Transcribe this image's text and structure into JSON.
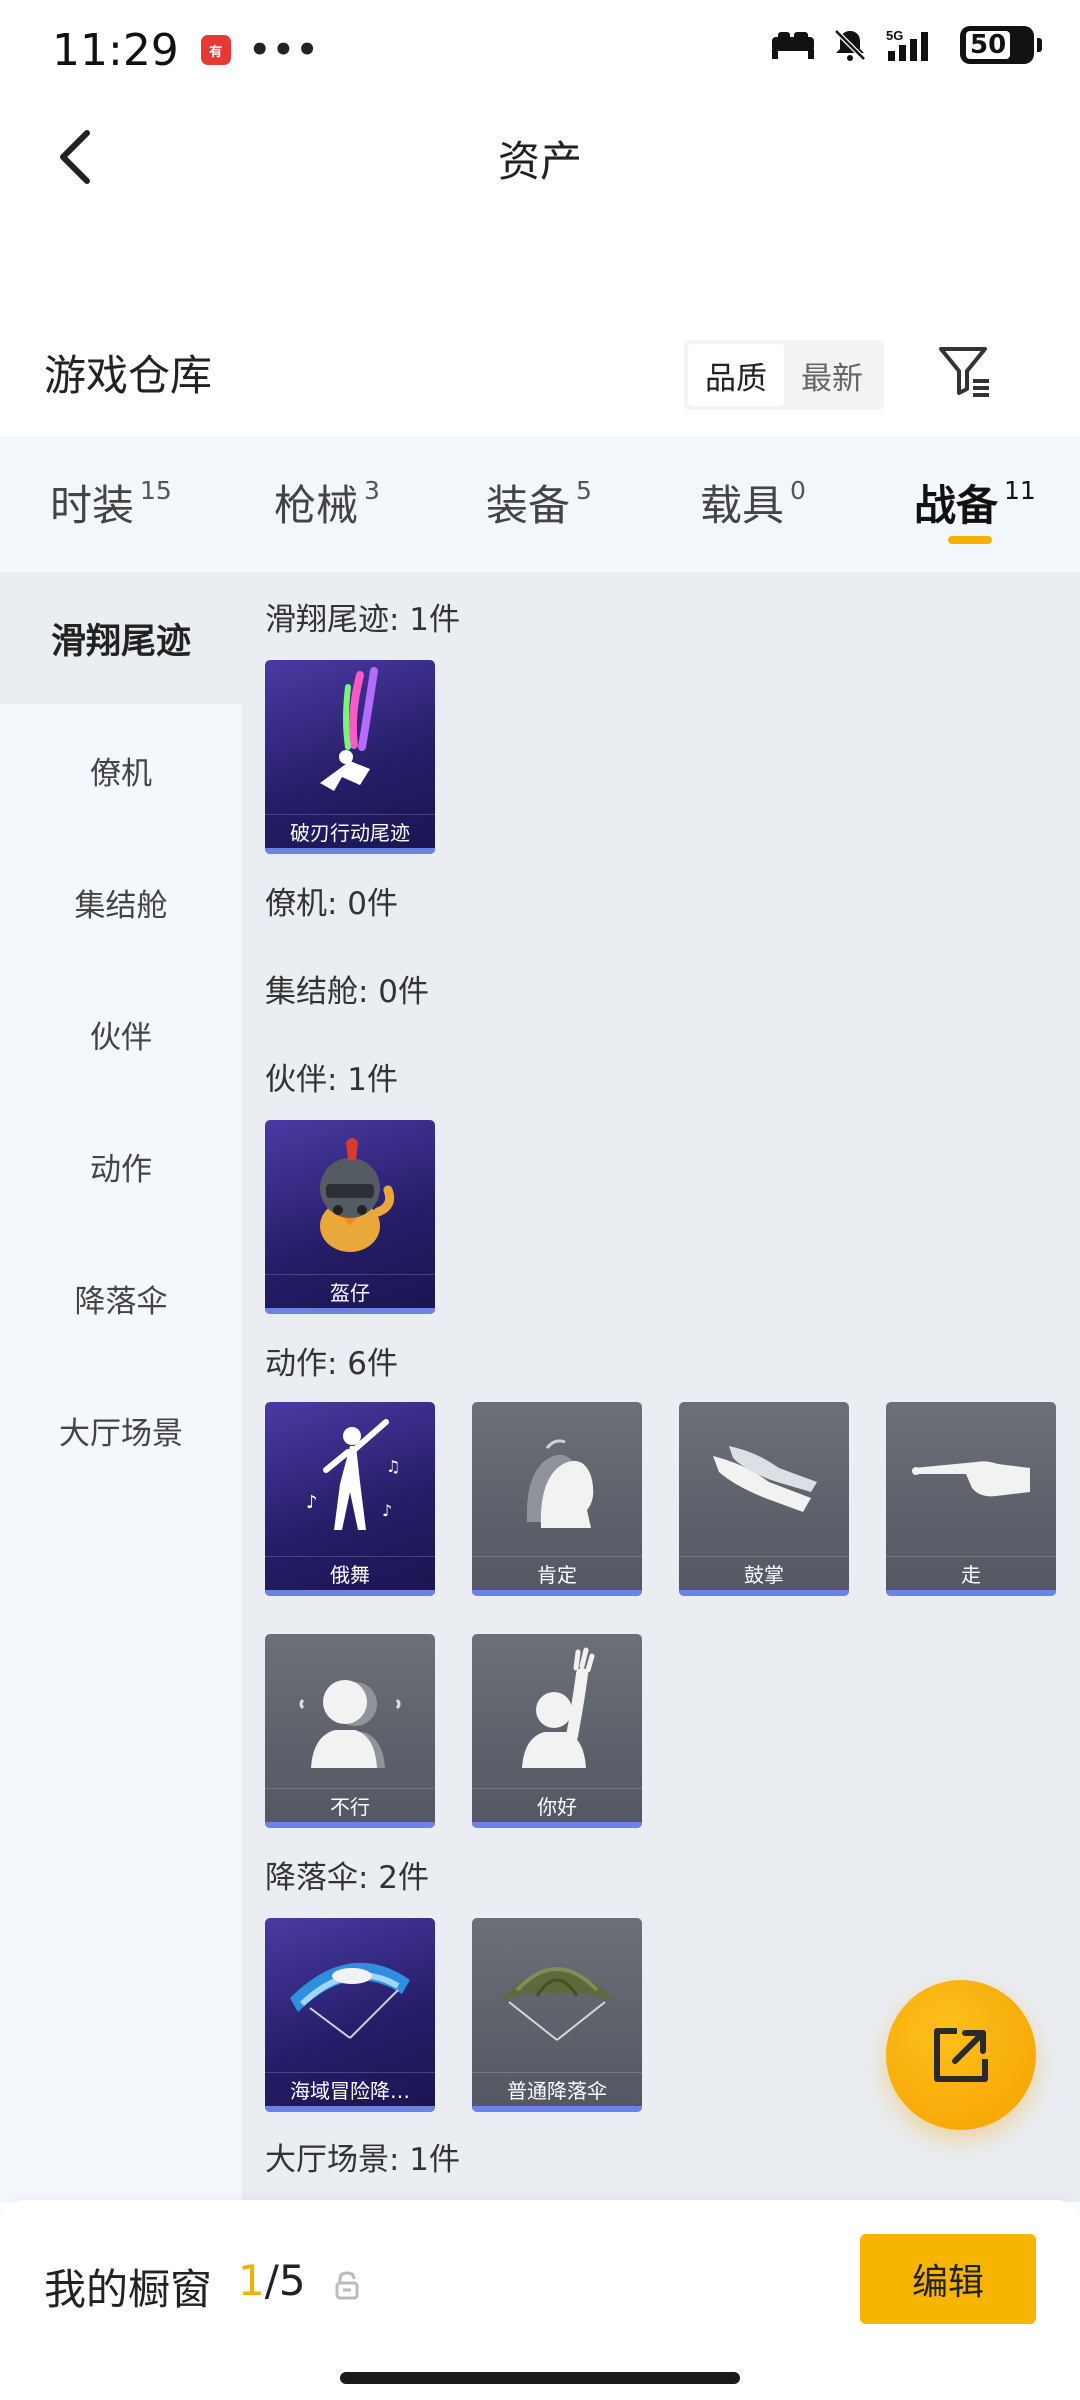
{
  "status": {
    "time": "11:29",
    "app_badge": "有点",
    "dots": "•••",
    "network": "5G",
    "battery": "50"
  },
  "header": {
    "title": "资产"
  },
  "section": {
    "title": "游戏仓库",
    "sort": [
      "品质",
      "最新"
    ]
  },
  "tabs": [
    {
      "label": "时装",
      "count": "15"
    },
    {
      "label": "枪械",
      "count": "3"
    },
    {
      "label": "装备",
      "count": "5"
    },
    {
      "label": "载具",
      "count": "0"
    },
    {
      "label": "战备",
      "count": "11"
    }
  ],
  "sidebar": [
    "滑翔尾迹",
    "僚机",
    "集结舱",
    "伙伴",
    "动作",
    "降落伞",
    "大厅场景"
  ],
  "groups": {
    "trail": {
      "label": "滑翔尾迹: 1件",
      "items": [
        "破刃行动尾迹"
      ]
    },
    "wingman": {
      "label": "僚机: 0件"
    },
    "capsule": {
      "label": "集结舱: 0件"
    },
    "partner": {
      "label": "伙伴: 1件",
      "items": [
        "盔仔"
      ]
    },
    "action": {
      "label": "动作: 6件",
      "items": [
        "俄舞",
        "肯定",
        "鼓掌",
        "走",
        "不行",
        "你好"
      ]
    },
    "parachute": {
      "label": "降落伞: 2件",
      "items": [
        "海域冒险降…",
        "普通降落伞"
      ]
    },
    "lobby": {
      "label": "大厅场景: 1件"
    }
  },
  "showcase": {
    "title": "我的橱窗",
    "current": "1",
    "total": "/5",
    "edit_label": "编辑"
  },
  "colors": {
    "accent": "#f5b000",
    "card_purple": "#2a2070",
    "card_grey": "#5c6069",
    "card_bar": "#6b82e6"
  }
}
